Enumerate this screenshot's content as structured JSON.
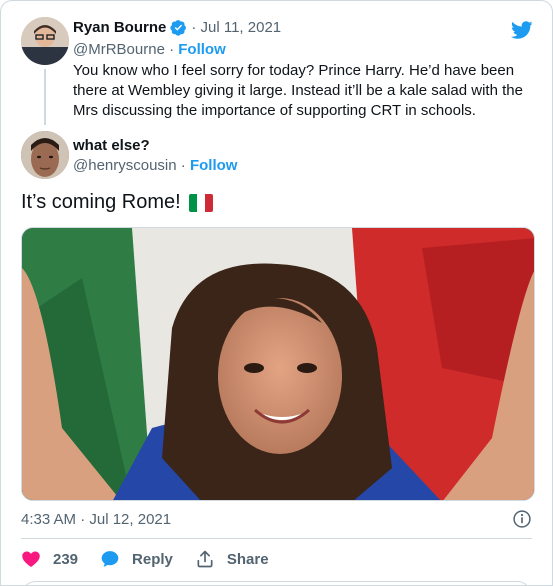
{
  "parent_tweet": {
    "author_name": "Ryan Bourne",
    "date": "· Jul 11, 2021",
    "handle": "@MrRBourne",
    "separator": " · ",
    "follow_label": "Follow",
    "text": "You know who I feel sorry for today? Prince Harry. He’d have been there at Wembley giving it large. Instead it’ll be a kale salad with the Mrs discussing the importance of supporting CRT in schools."
  },
  "main_tweet": {
    "author_name": "what else?",
    "handle": "@henryscousin",
    "separator": " · ",
    "follow_label": "Follow",
    "text": "It’s coming Rome!",
    "flag_emoji": "italy-flag",
    "timestamp": "4:33 AM · Jul 12, 2021"
  },
  "actions": {
    "like_count": "239",
    "reply_label": "Reply",
    "share_label": "Share"
  },
  "colors": {
    "twitter_blue": "#1d9bf0",
    "like_pink": "#f91880",
    "text_secondary": "#536471",
    "border": "#cfd9de"
  }
}
